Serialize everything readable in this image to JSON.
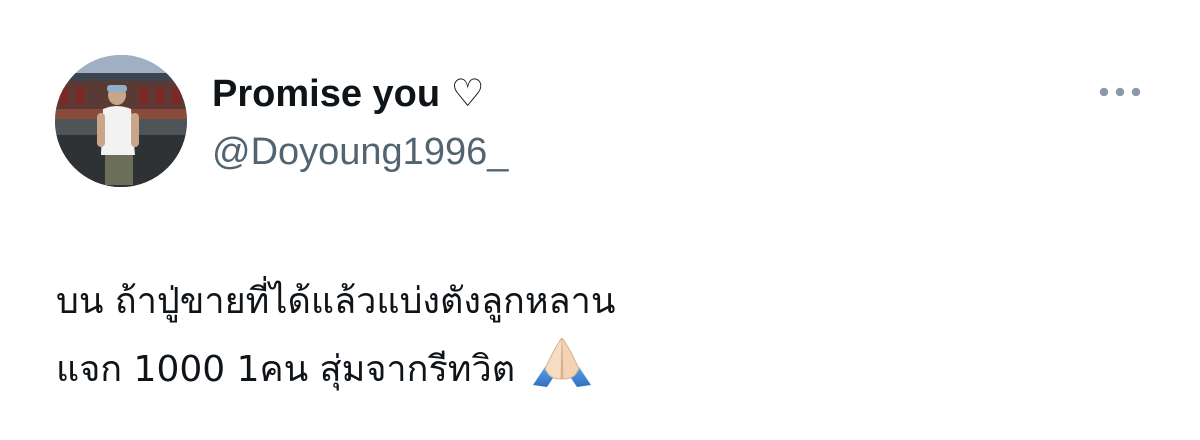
{
  "author": {
    "display_name": "Promise you ♡",
    "handle": "@Doyoung1996_"
  },
  "menu": {
    "icon": "more-horizontal-icon"
  },
  "tweet": {
    "lines": [
      "บน ถ้าปู่ขายที่ได้แล้วแบ่งตังลูกหลาน",
      "แจก 1000 1คน สุ่มจากรีทวิต"
    ],
    "emoji": "folded-hands-icon"
  },
  "colors": {
    "text": "#0f1419",
    "secondary_text": "#536471",
    "menu_dots": "#8b98a5",
    "background": "#ffffff"
  }
}
